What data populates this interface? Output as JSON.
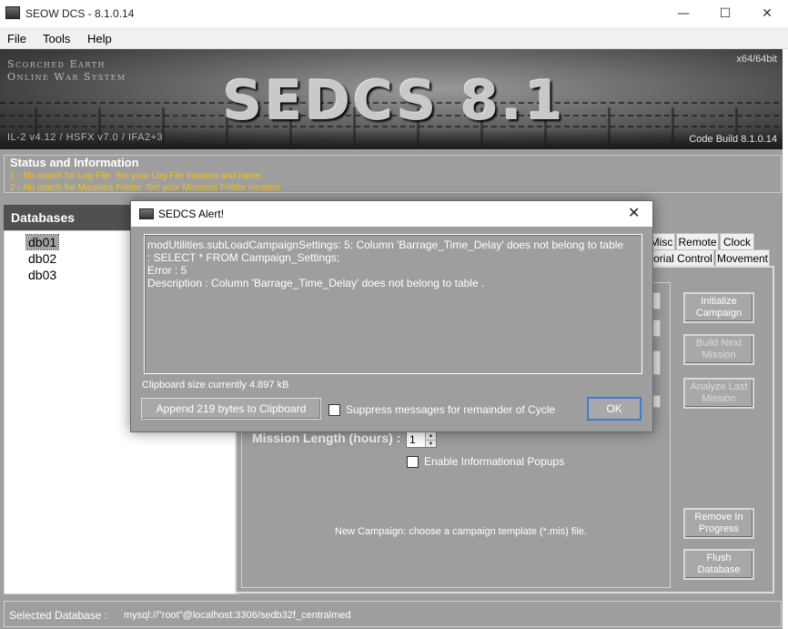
{
  "window": {
    "title": "SEOW DCS - 8.1.0.14",
    "min_glyph": "—",
    "max_glyph": "☐",
    "close_glyph": "✕"
  },
  "menu": [
    "File",
    "Tools",
    "Help"
  ],
  "banner": {
    "line1": "Scorched Earth",
    "line2": "Online War System",
    "big_title": "SEDCS 8.1",
    "arch": "x64/64bit",
    "il2": "IL-2 v4.12 / HSFX v7.0 / IFA2+3",
    "build": "Code Build 8.1.0.14"
  },
  "status": {
    "title": "Status and Information",
    "lines": [
      "1 - No match for Log File. Set your Log File location and name.",
      "2 - No match for Missions Folder. Set your Missions Folder location."
    ]
  },
  "databases": {
    "header": "Databases",
    "items": [
      "db01",
      "db02",
      "db03"
    ],
    "selected": "db01"
  },
  "tabs": {
    "row1": [
      "Misc",
      "Remote",
      "Clock"
    ],
    "row2": [
      "ritorial Control",
      "Movement"
    ]
  },
  "campaign": {
    "mission_length_label": "Mission Length (hours) :",
    "mission_length_value": "1",
    "enable_popups_label": "Enable Informational Popups",
    "new_campaign_msg": "New Campaign: choose a campaign template (*.mis) file.",
    "buttons": {
      "initialize": "Initialize Campaign",
      "build_next": "Build Next Mission",
      "analyze_last": "Analyze Last Mission",
      "remove_in_progress": "Remove In Progress",
      "flush_database": "Flush Database"
    }
  },
  "footer": {
    "label": "Selected Database :",
    "value": "mysql://\"root\"@localhost:3306/sedb32f_centralmed"
  },
  "dialog": {
    "title": "SEDCS Alert!",
    "close_glyph": "✕",
    "message_lines": [
      "modUtilities.subLoadCampaignSettings: 5: Column 'Barrage_Time_Delay' does not belong to table",
      ": SELECT * FROM Campaign_Settings;",
      "Error : 5",
      "Description : Column 'Barrage_Time_Delay' does not belong to table ."
    ],
    "clipboard_size": "Clipboard size currently 4.897 kB",
    "append_button": "Append 219 bytes to Clipboard",
    "suppress_label": "Suppress messages for remainder of Cycle",
    "ok_button": "OK"
  },
  "colors": {
    "workspace": "#9e9e9e",
    "status_text": "#f2c511",
    "db_header": "#505050",
    "ok_border": "#3d7bd6"
  }
}
